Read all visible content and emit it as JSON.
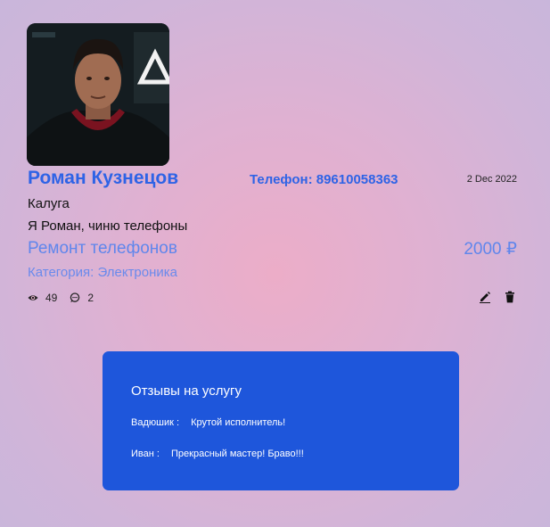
{
  "profile": {
    "name": "Роман Кузнецов",
    "phone": "Телефон: 89610058363",
    "date": "2 Dec 2022",
    "city": "Калуга",
    "description": "Я Роман, чиню телефоны",
    "avatar": "user-photo"
  },
  "service": {
    "title": "Ремонт телефонов",
    "price": "2000 ₽",
    "category": "Категория: Электроника"
  },
  "stats": {
    "views": "49",
    "comments": "2",
    "views_icon": "eye-icon",
    "comments_icon": "comment-icon"
  },
  "actions": {
    "edit_icon": "pencil-icon",
    "delete_icon": "trash-icon"
  },
  "reviews": {
    "title": "Отзывы на услугу",
    "items": [
      {
        "author": "Вадюшик :",
        "text": "Крутой исполнитель!"
      },
      {
        "author": "Иван :",
        "text": "Прекрасный мастер! Браво!!!"
      }
    ]
  },
  "colors": {
    "accent": "#2e63e6",
    "accent_light": "#5f86ec",
    "reviews_bg": "#1e56db"
  }
}
